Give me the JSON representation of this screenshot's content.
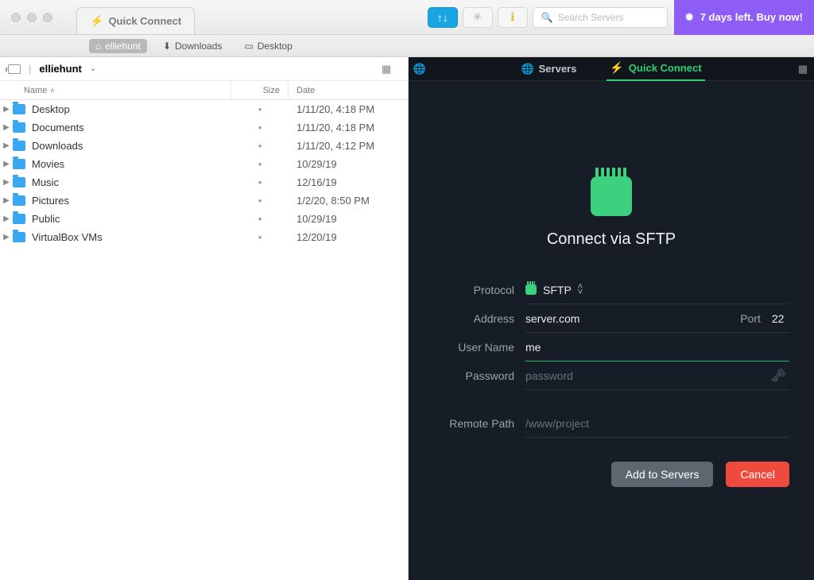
{
  "titlebar": {
    "tab_label": "Quick Connect",
    "search_placeholder": "Search Servers",
    "trial_text": "7 days left. Buy now!"
  },
  "crumbs": {
    "home": "elliehunt",
    "downloads": "Downloads",
    "desktop": "Desktop"
  },
  "local": {
    "location": "elliehunt",
    "col_name": "Name",
    "col_size": "Size",
    "col_date": "Date",
    "files": [
      {
        "name": "Desktop",
        "size": "•",
        "date": "1/11/20, 4:18 PM"
      },
      {
        "name": "Documents",
        "size": "•",
        "date": "1/11/20, 4:18 PM"
      },
      {
        "name": "Downloads",
        "size": "•",
        "date": "1/11/20, 4:12 PM"
      },
      {
        "name": "Movies",
        "size": "•",
        "date": "10/29/19"
      },
      {
        "name": "Music",
        "size": "•",
        "date": "12/16/19"
      },
      {
        "name": "Pictures",
        "size": "•",
        "date": "1/2/20, 8:50 PM"
      },
      {
        "name": "Public",
        "size": "•",
        "date": "10/29/19"
      },
      {
        "name": "VirtualBox VMs",
        "size": "•",
        "date": "12/20/19"
      }
    ]
  },
  "remote_tabs": {
    "servers": "Servers",
    "quick_connect": "Quick Connect"
  },
  "connect": {
    "title": "Connect via SFTP",
    "labels": {
      "protocol": "Protocol",
      "address": "Address",
      "port": "Port",
      "username": "User Name",
      "password": "Password",
      "remote_path": "Remote Path"
    },
    "values": {
      "protocol": "SFTP",
      "address": "server.com",
      "port": "22",
      "username": "me"
    },
    "placeholders": {
      "password": "password",
      "remote_path": "/www/project"
    },
    "buttons": {
      "add": "Add to Servers",
      "cancel": "Cancel"
    }
  }
}
